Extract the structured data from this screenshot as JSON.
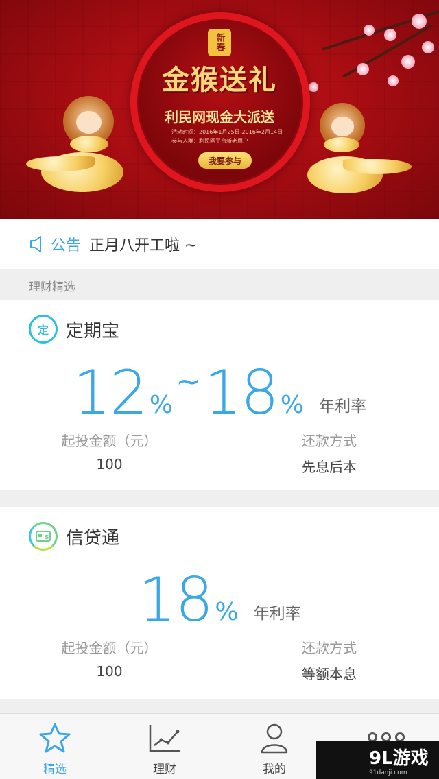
{
  "banner": {
    "seal": "新春",
    "title": "金猴送礼",
    "subtitle": "利民网现金大派送",
    "activity_time": "活动时间：2016年1月25日-2016年2月14日",
    "participants": "参与人群：利民网平台新老用户",
    "join_button": "我要参与"
  },
  "notice": {
    "label": "公告",
    "text": "正月八开工啦 ~"
  },
  "section_label": "理财精选",
  "products": [
    {
      "icon_char": "定",
      "icon": "ding-badge-icon",
      "name": "定期宝",
      "rate_low": "12",
      "rate_high": "18",
      "pct": "%",
      "tilde": "~",
      "rate_unit": "年利率",
      "min_invest_label": "起投金额（元）",
      "min_invest_value": "100",
      "repay_label": "还款方式",
      "repay_value": "先息后本"
    },
    {
      "icon": "cash-card-icon",
      "name": "信贷通",
      "rate": "18",
      "pct": "%",
      "rate_unit": "年利率",
      "min_invest_label": "起投金额（元）",
      "min_invest_value": "100",
      "repay_label": "还款方式",
      "repay_value": "等额本息"
    }
  ],
  "tabbar": {
    "tabs": [
      {
        "label": "精选",
        "icon": "star-icon",
        "active": true
      },
      {
        "label": "理财",
        "icon": "line-chart-icon",
        "active": false
      },
      {
        "label": "我的",
        "icon": "user-icon",
        "active": false
      }
    ]
  },
  "watermark": {
    "brand": "9L游戏",
    "site": "91danji.com"
  },
  "colors": {
    "accent": "#3aa7e6",
    "banner_red": "#a70d12"
  }
}
